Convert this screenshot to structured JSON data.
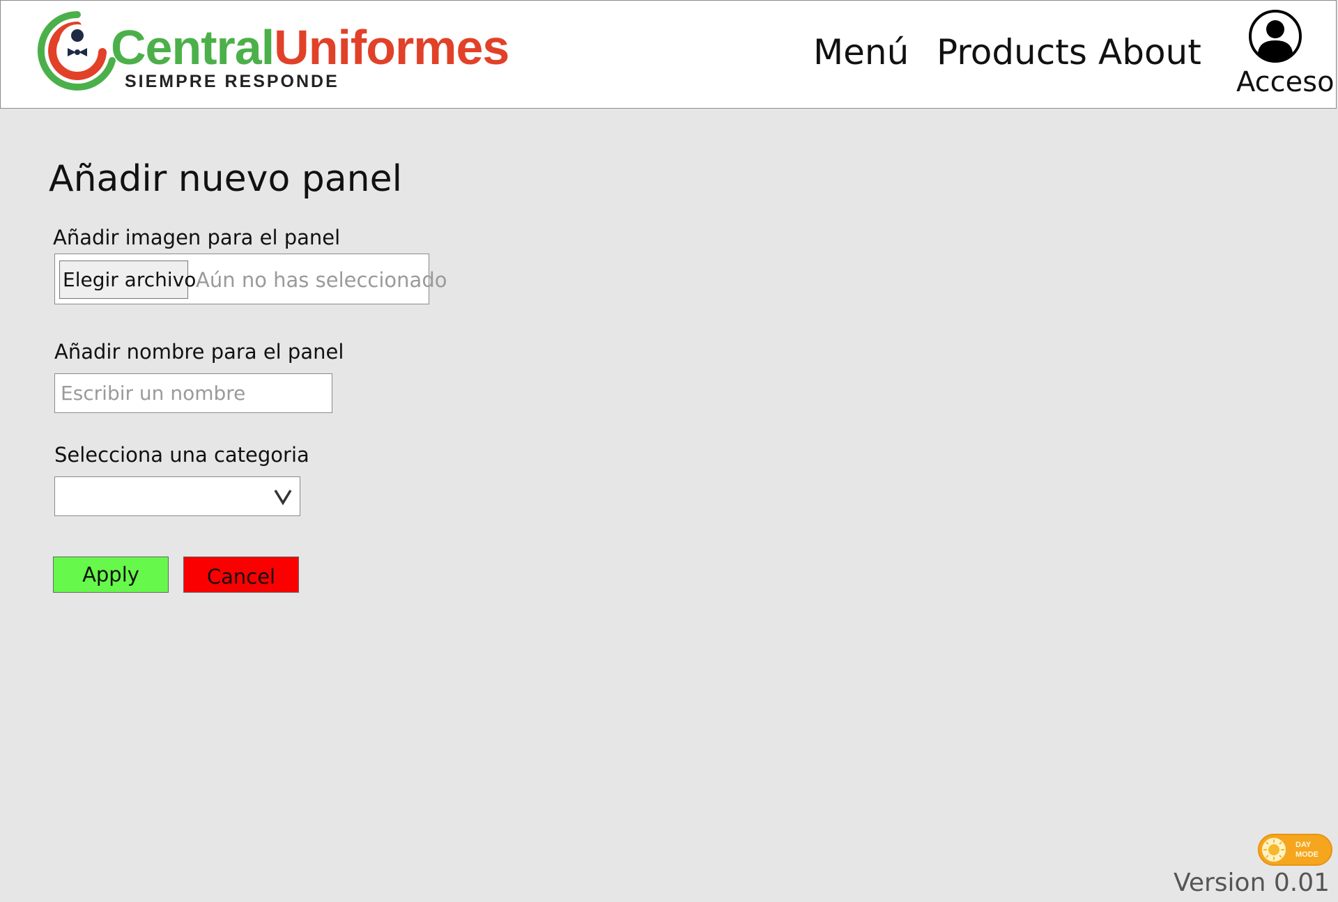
{
  "header": {
    "logo_word_1": "Central",
    "logo_word_2": "Uniformes",
    "logo_tagline": "SIEMPRE RESPONDE",
    "nav": {
      "menu": "Menú",
      "products": "Products",
      "about": "About"
    },
    "user": {
      "label": "Acceso",
      "icon": "user-circle-icon"
    }
  },
  "form": {
    "title": "Añadir nuevo panel",
    "image_label": "Añadir imagen para el panel",
    "file_button": "Elegir archivo",
    "file_status": "Aún no has seleccionado",
    "name_label": "Añadir nombre para el panel",
    "name_placeholder": "Escribir un nombre",
    "name_value": "",
    "category_label": "Selecciona una categoria",
    "category_value": "",
    "apply": "Apply",
    "cancel": "Cancel"
  },
  "footer": {
    "toggle_line1": "DAY",
    "toggle_line2": "MODE",
    "version": "Version 0.01"
  },
  "colors": {
    "page_bg": "#e6e6e6",
    "brand_green": "#4cb04a",
    "brand_red": "#e14128",
    "apply_bg": "#66f84a",
    "cancel_bg": "#fa0000",
    "toggle_bg": "#f5a61e"
  }
}
